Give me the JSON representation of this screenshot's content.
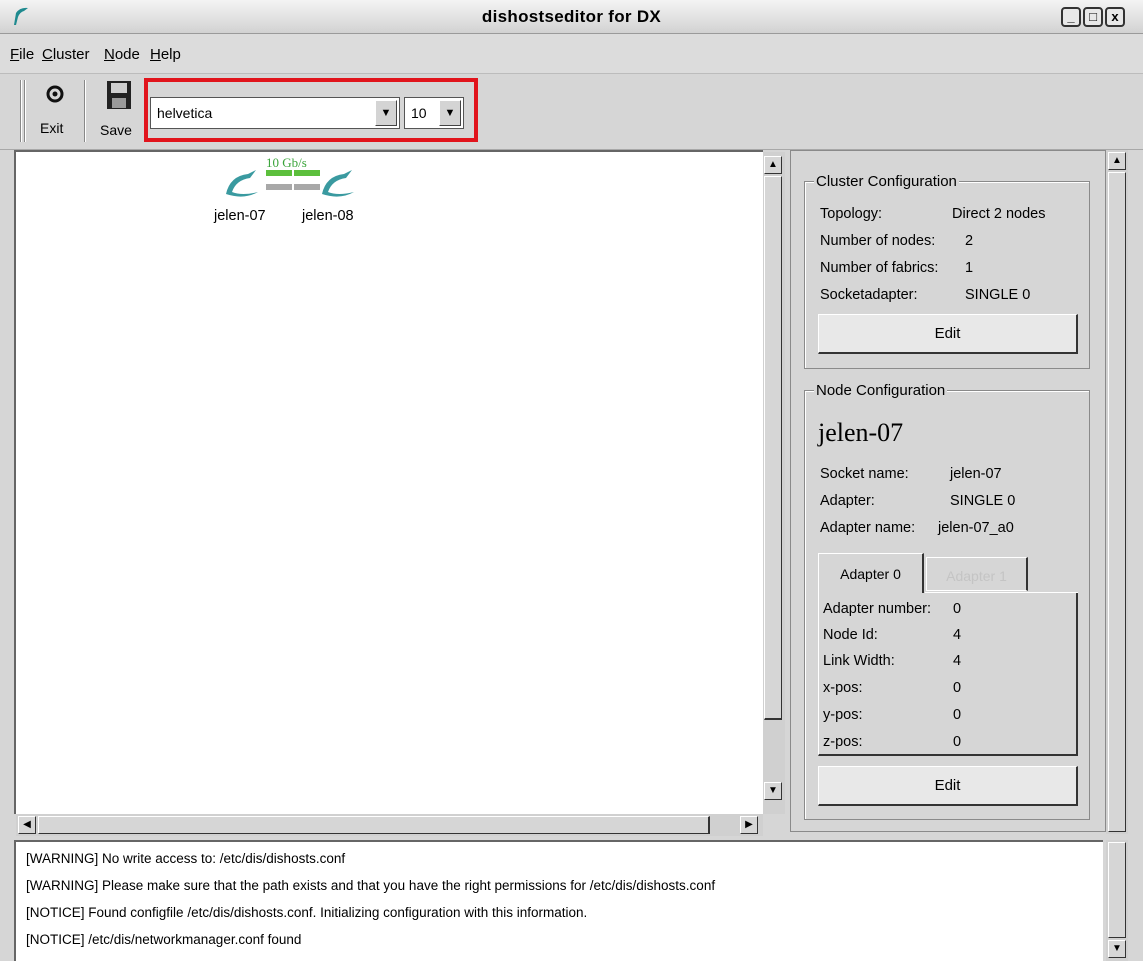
{
  "window": {
    "title": "dishostseditor for DX",
    "minimize": "_",
    "maximize": "□",
    "close": "x"
  },
  "menu": [
    "File",
    "Cluster",
    "Node",
    "Help"
  ],
  "toolbar": {
    "exit_label": "Exit",
    "save_label": "Save",
    "font_value": "helvetica",
    "size_value": "10"
  },
  "canvas": {
    "link_label": "10  Gb/s",
    "nodes": [
      "jelen-07",
      "jelen-08"
    ],
    "colors": {
      "link_green": "#5cbf3c",
      "link_gray": "#a8a8a8",
      "node_teal": "#3a9aa0"
    }
  },
  "cluster_config": {
    "title": "Cluster Configuration",
    "topology_label": "Topology:",
    "topology_value": "Direct 2 nodes",
    "nodes_label": "Number of nodes:",
    "nodes_value": "2",
    "fabrics_label": "Number of fabrics:",
    "fabrics_value": "1",
    "socketadapter_label": "Socketadapter:",
    "socketadapter_value": "SINGLE 0",
    "edit_label": "Edit"
  },
  "node_config": {
    "title": "Node Configuration",
    "node_name": "jelen-07",
    "socket_label": "Socket name:",
    "socket_value": "jelen-07",
    "adapter_label": "Adapter:",
    "adapter_value": "SINGLE 0",
    "adapter_name_label": "Adapter name:",
    "adapter_name_value": "jelen-07_a0",
    "tabs": [
      "Adapter 0",
      "Adapter 1"
    ],
    "adapter_fields": {
      "number_label": "Adapter number:",
      "number_value": "0",
      "nodeid_label": "Node Id:",
      "nodeid_value": "4",
      "linkwidth_label": "Link Width:",
      "linkwidth_value": "4",
      "xpos_label": "x-pos:",
      "xpos_value": "0",
      "ypos_label": "y-pos:",
      "ypos_value": "0",
      "zpos_label": "z-pos:",
      "zpos_value": "0"
    },
    "edit_label": "Edit"
  },
  "log": [
    "[WARNING] No write access to: /etc/dis/dishosts.conf",
    "[WARNING] Please make sure that the path exists and that you have the right permissions for /etc/dis/dishosts.conf",
    "[NOTICE] Found configfile /etc/dis/dishosts.conf. Initializing configuration with this information.",
    "[NOTICE] /etc/dis/networkmanager.conf found"
  ],
  "accent": {
    "highlight_box": "#e1141c"
  }
}
